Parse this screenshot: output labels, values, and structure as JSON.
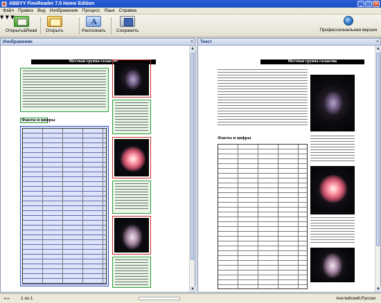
{
  "window": {
    "title": "ABBYY FineReader 7.0 Home Edition"
  },
  "menu": [
    "Файл",
    "Правка",
    "Вид",
    "Изображение",
    "Процесс",
    "Язык",
    "Справка"
  ],
  "toolbar": {
    "openread_label": "Открыть&Read",
    "open_label": "Открыть",
    "recognize_label": "Распознать",
    "save_label": "Сохранить",
    "professional_label": "Профессиональная версия"
  },
  "image_pane": {
    "title": "Изображение",
    "doc_title": "Местная группа галактик",
    "section_heading": "Факты и цифры"
  },
  "text_pane": {
    "title": "Текст",
    "doc_title": "Местная группа галактик",
    "section_heading": "Факты и цифры"
  },
  "status": {
    "page_indicator": "1 из 1",
    "language": "Английский;Русски"
  },
  "colors": {
    "titlebar": "#1f4fc1",
    "text_zone": "#2f9a3a",
    "picture_zone": "#c72a2a",
    "table_zone": "#2c50c8"
  }
}
